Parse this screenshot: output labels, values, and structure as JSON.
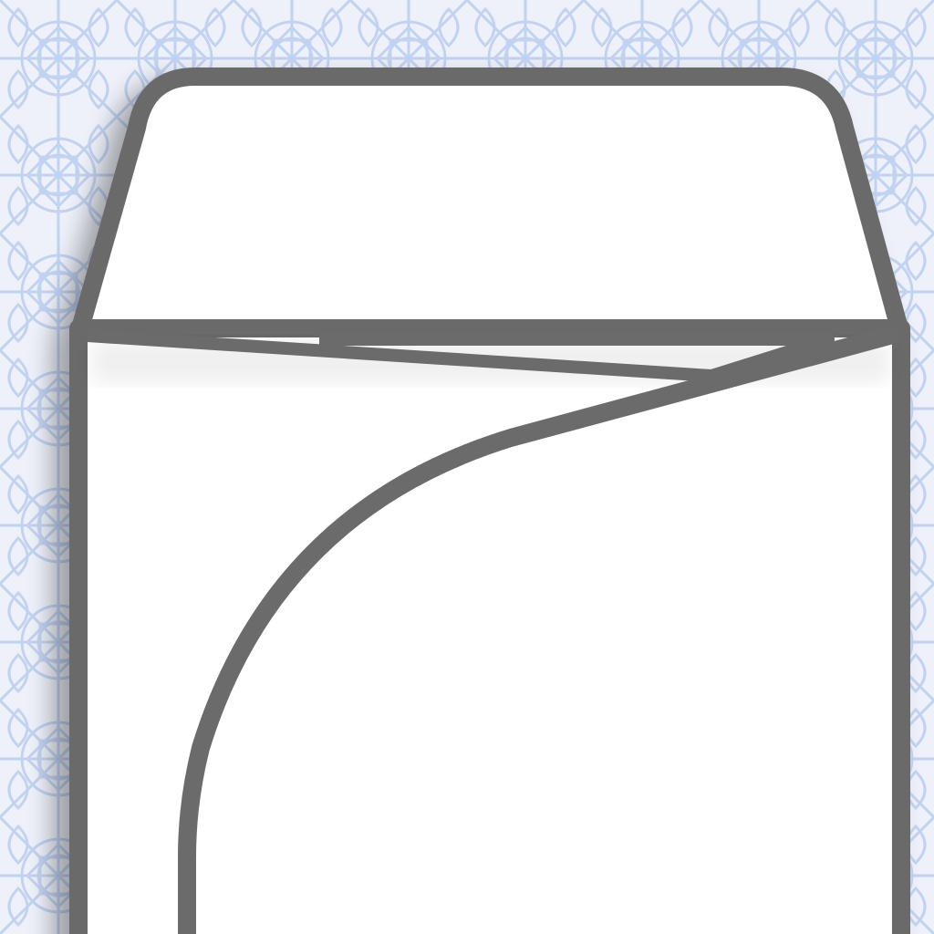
{
  "background": {
    "base_color": "#eef1fa",
    "pattern_color": "#c2d3f2",
    "pattern": "lace-ornament"
  },
  "envelope": {
    "fill_color": "#ffffff",
    "outline_color": "#6b6b6b",
    "shadow_color": "#000000",
    "icon_name": "envelope-icon",
    "flap_state": "open"
  }
}
